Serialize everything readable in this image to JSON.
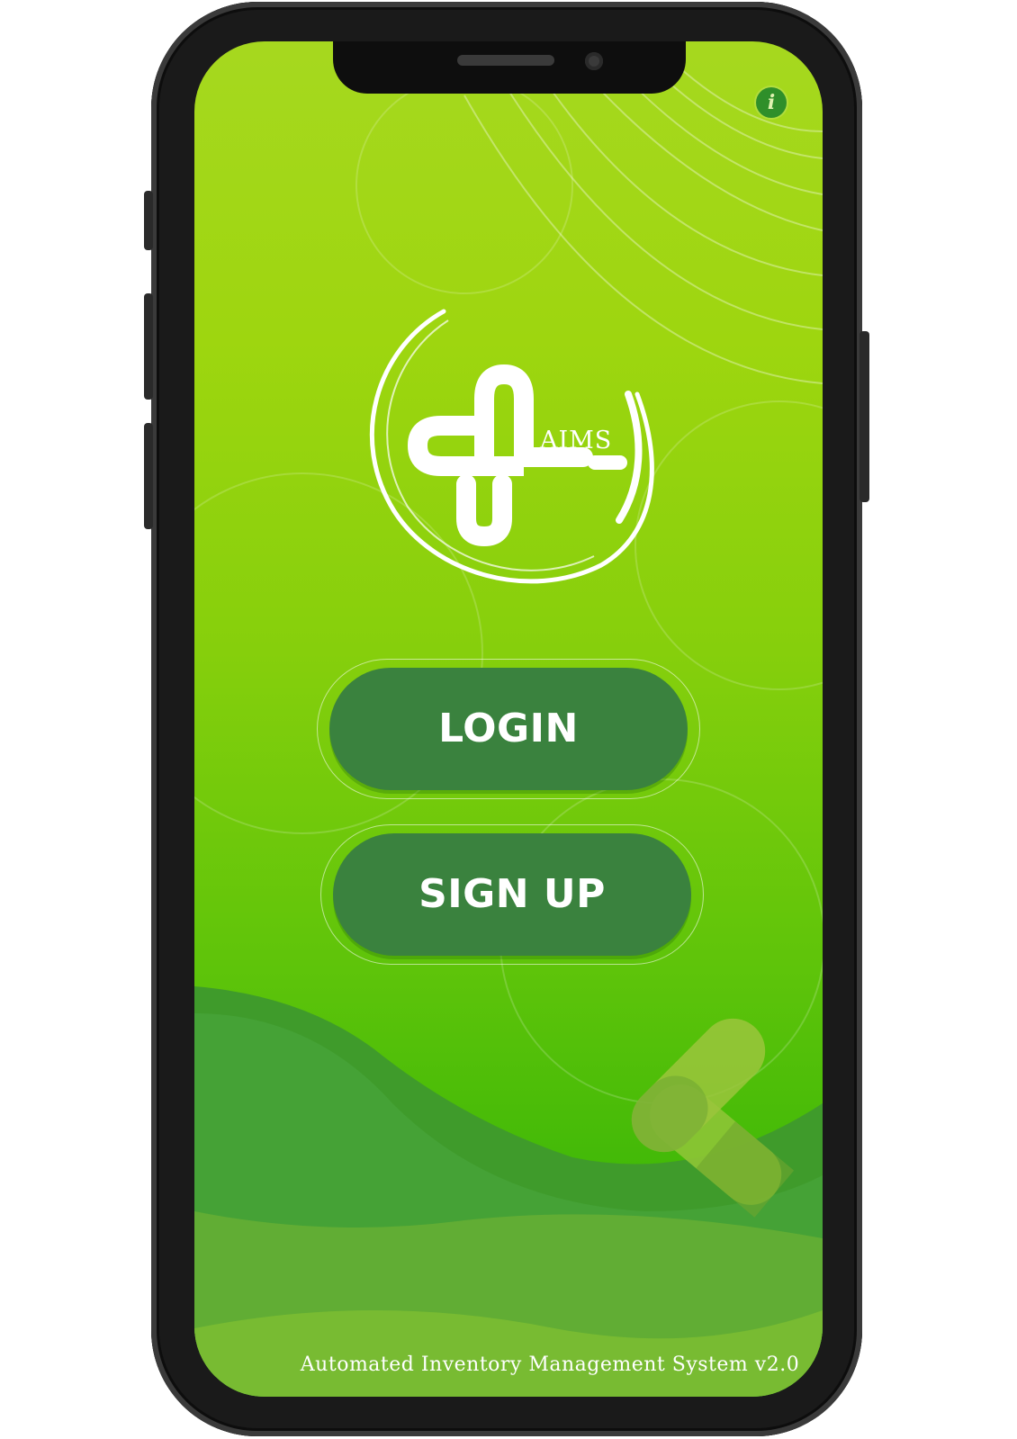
{
  "app": {
    "logo_text": "AIMS",
    "tagline": "Automated Inventory Management System v2.0"
  },
  "header": {
    "info_icon": "info-icon",
    "info_glyph": "i"
  },
  "actions": {
    "login_label": "LOGIN",
    "signup_label": "SIGN UP"
  },
  "colors": {
    "button_bg": "#3a823e",
    "screen_top": "#a6d81f",
    "screen_bottom": "#37b006",
    "info_icon_bg": "#2f8f2a"
  }
}
